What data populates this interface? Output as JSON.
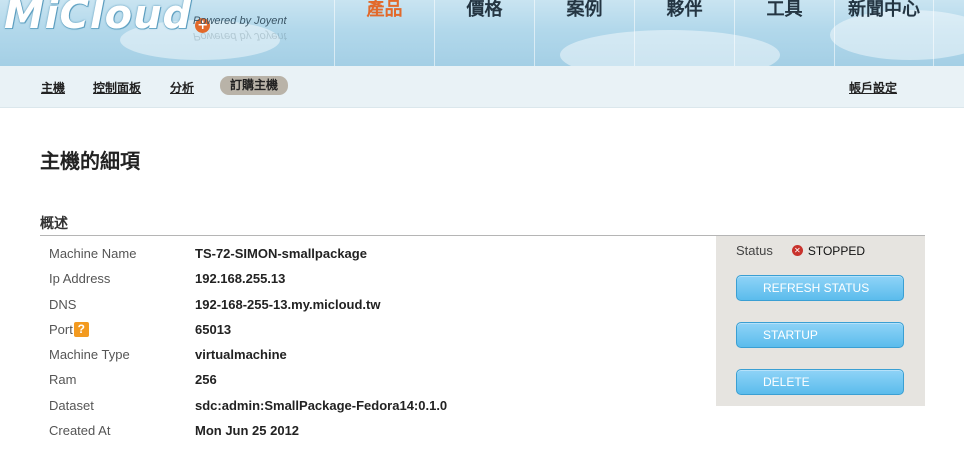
{
  "header": {
    "logo_text": "MiCloud",
    "logo_plus": "+",
    "powered_by": "Powered by Joyent",
    "nav": [
      {
        "label": "產品",
        "active": true
      },
      {
        "label": "價格",
        "active": false
      },
      {
        "label": "案例",
        "active": false
      },
      {
        "label": "夥伴",
        "active": false
      },
      {
        "label": "工具",
        "active": false
      },
      {
        "label": "新聞中心",
        "active": false
      }
    ]
  },
  "subnav": {
    "items": [
      {
        "label": "主機"
      },
      {
        "label": "控制面板"
      },
      {
        "label": "分析"
      },
      {
        "label": "訂購主機",
        "selected": true
      }
    ],
    "account": "帳戶設定"
  },
  "page": {
    "title": "主機的細項",
    "section": "概述"
  },
  "details": [
    {
      "label": "Machine Name",
      "value": "TS-72-SIMON-smallpackage"
    },
    {
      "label": "Ip Address",
      "value": "192.168.255.13"
    },
    {
      "label": "DNS",
      "value": "192-168-255-13.my.micloud.tw"
    },
    {
      "label": "Port",
      "value": "65013",
      "help_icon": "?"
    },
    {
      "label": "Machine Type",
      "value": "virtualmachine"
    },
    {
      "label": "Ram",
      "value": "256"
    },
    {
      "label": "Dataset",
      "value": "sdc:admin:SmallPackage-Fedora14:0.1.0"
    },
    {
      "label": "Created At",
      "value": "Mon Jun 25 2012"
    }
  ],
  "status": {
    "label": "Status",
    "value": "STOPPED",
    "icon": "stopped-icon",
    "icon_glyph": "✕"
  },
  "actions": {
    "refresh": "REFRESH STATUS",
    "startup": "STARTUP",
    "delete": "DELETE"
  },
  "colors": {
    "accent_orange": "#e2692a",
    "button_blue": "#5bbcec",
    "status_red": "#c8322c",
    "help_orange": "#f39a1f"
  }
}
